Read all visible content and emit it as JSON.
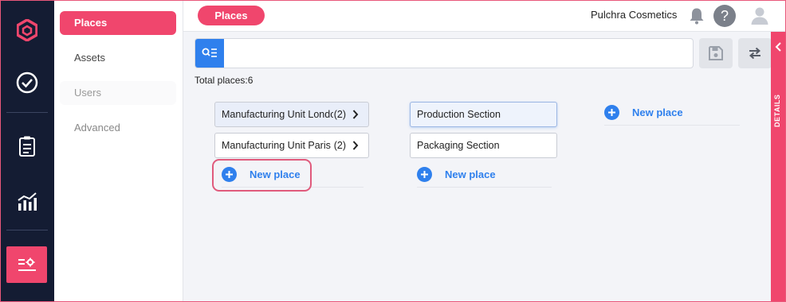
{
  "app": {
    "company": "Pulchra Cosmetics",
    "accent": "#f0466d",
    "primary_blue": "#2f80ed"
  },
  "rail": {
    "icons": [
      "logo-hexagon-icon",
      "check-circle-icon",
      "clipboard-list-icon",
      "analytics-chart-icon",
      "settings-sliders-icon"
    ]
  },
  "subnav": {
    "items": [
      {
        "label": "Places"
      },
      {
        "label": "Assets"
      },
      {
        "label": "Users"
      },
      {
        "label": "Advanced"
      }
    ]
  },
  "header": {
    "breadcrumb": "Places",
    "company": "Pulchra Cosmetics"
  },
  "toolbar": {
    "search_value": "",
    "total_label": "Total places:6"
  },
  "columns": [
    {
      "places": [
        {
          "name": "Manufacturing Unit London",
          "count": "(2)"
        },
        {
          "name": "Manufacturing Unit Paris",
          "count": "(2)"
        }
      ],
      "new_label": "New place"
    },
    {
      "places": [
        {
          "name": "Production Section"
        },
        {
          "name": "Packaging Section"
        }
      ],
      "new_label": "New place"
    },
    {
      "places": [],
      "new_label": "New place"
    }
  ],
  "details_tab": "DETAILS"
}
